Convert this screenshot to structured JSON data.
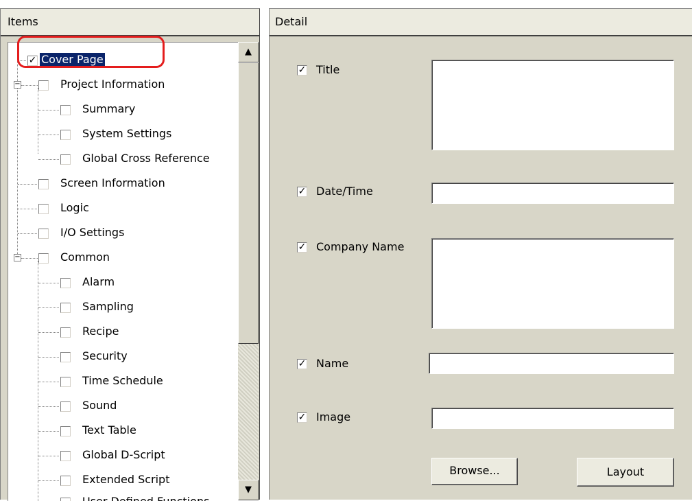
{
  "items_panel": {
    "header": "Items",
    "tree": [
      {
        "label": "Cover Page",
        "checked": true,
        "selected": true
      },
      {
        "label": "Project Information",
        "checked": false,
        "expander": "−"
      },
      {
        "label": "Summary",
        "checked": false
      },
      {
        "label": "System Settings",
        "checked": false
      },
      {
        "label": "Global Cross Reference",
        "checked": false
      },
      {
        "label": "Screen Information",
        "checked": false
      },
      {
        "label": "Logic",
        "checked": false
      },
      {
        "label": "I/O Settings",
        "checked": false
      },
      {
        "label": "Common",
        "checked": false,
        "expander": "−"
      },
      {
        "label": "Alarm",
        "checked": false
      },
      {
        "label": "Sampling",
        "checked": false
      },
      {
        "label": "Recipe",
        "checked": false
      },
      {
        "label": "Security",
        "checked": false
      },
      {
        "label": "Time Schedule",
        "checked": false
      },
      {
        "label": "Sound",
        "checked": false
      },
      {
        "label": "Text Table",
        "checked": false
      },
      {
        "label": "Global D-Script",
        "checked": false
      },
      {
        "label": "Extended Script",
        "checked": false
      },
      {
        "label": "User Defined Functions",
        "checked": false
      }
    ],
    "scroll_up": "▲",
    "scroll_down": "▼"
  },
  "detail_panel": {
    "header": "Detail",
    "fields": {
      "title": {
        "label": "Title",
        "checked": true,
        "value": ""
      },
      "datetime": {
        "label": "Date/Time",
        "checked": true,
        "value": ""
      },
      "company": {
        "label": "Company Name",
        "checked": true,
        "value": ""
      },
      "name": {
        "label": "Name",
        "checked": true,
        "value": ""
      },
      "image": {
        "label": "Image",
        "checked": true,
        "value": ""
      }
    },
    "browse_label": "Browse...",
    "layout_label": "Layout"
  },
  "check_glyph": "✓",
  "colors": {
    "panel": "#d8d6c8",
    "selection": "#0a246a",
    "highlight": "#e41d1d"
  }
}
